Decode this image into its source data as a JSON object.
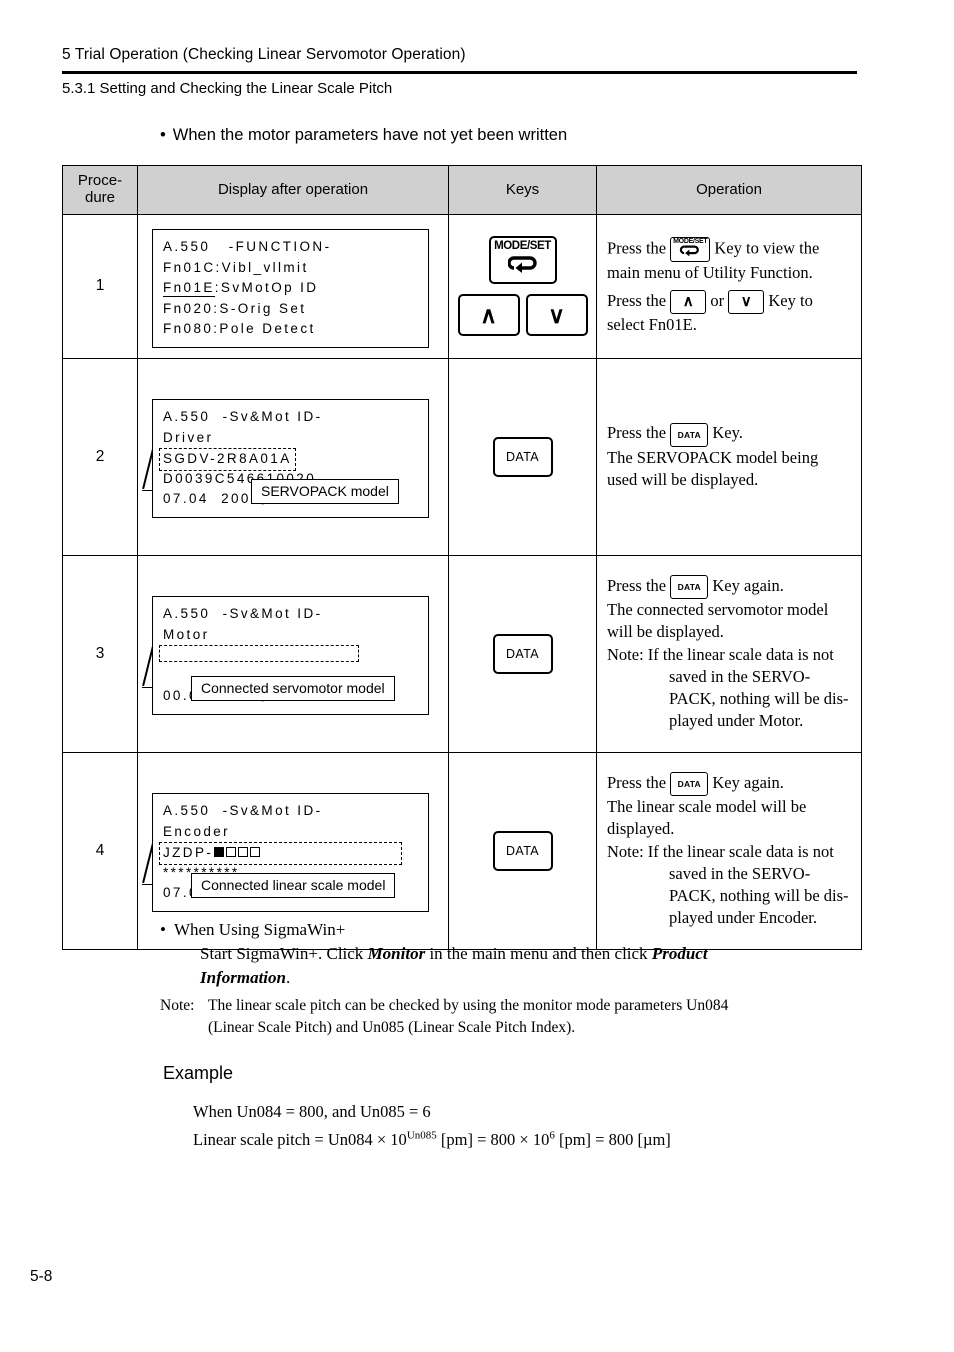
{
  "header": {
    "chapter": "5  Trial Operation (Checking Linear Servomotor Operation)",
    "section": "5.3.1  Setting and Checking the Linear Scale Pitch"
  },
  "intro_bullet": "When the motor parameters have not yet been written",
  "table": {
    "columns": {
      "procedure": "Proce-\ndure",
      "display": "Display after operation",
      "keys": "Keys",
      "operation": "Operation"
    },
    "rows": [
      {
        "number": "1",
        "lcd": {
          "lines": [
            "A.550   -FUNCTION-",
            "Fn01C:Vibl_vllmit",
            "Fn01E:SvMotOp ID",
            "Fn020:S-Orig Set",
            "Fn080:Pole Detect"
          ],
          "selected_prefix": "Fn01E",
          "selected_rest": ":SvMotOp ID"
        },
        "keys": {
          "modeset_label": "MODE/SET",
          "up_label": "∧",
          "down_label": "∨"
        },
        "operation": {
          "l1a": "Press the",
          "l1b": "Key to view the",
          "l2": "main menu of Utility Function.",
          "l3a": "Press the",
          "l3b": "or",
          "l3c": "Key to",
          "l4": "select Fn01E."
        }
      },
      {
        "number": "2",
        "lcd": {
          "line1": "A.550  -Sv&Mot ID-",
          "line2": "Driver",
          "boxed": "SGDV-2R8A01A",
          "line4": "D0039C546610020",
          "line5": "07.04  200V,  400W"
        },
        "callout": "SERVOPACK model",
        "keys": {
          "data_label": "DATA"
        },
        "operation": {
          "l1a": "Press the",
          "l1b": "Key.",
          "l2": "The SERVOPACK model being",
          "l3": "used will be displayed."
        }
      },
      {
        "number": "3",
        "lcd": {
          "line1": "A.550  -Sv&Mot ID-",
          "line2": "Motor",
          "boxed": "",
          "line4": "",
          "line5": "00.00  100V,      W"
        },
        "callout": "Connected servomotor model",
        "keys": {
          "data_label": "DATA"
        },
        "operation": {
          "l1a": "Press the",
          "l1b": "Key again.",
          "l2": "The connected servomotor model",
          "l3": "will be displayed.",
          "l4": "Note: If the linear scale data is not",
          "l5": "saved in the SERVO-",
          "l6": "PACK, nothing will be dis-",
          "l7": "played under Motor."
        }
      },
      {
        "number": "4",
        "lcd": {
          "line1": "A.550  -Sv&Mot ID-",
          "line2": "Encoder",
          "boxed_prefix": "JZDP-",
          "boxed_squares": [
            "filled",
            "hollow",
            "hollow",
            "hollow"
          ],
          "line4": "**********",
          "line5": "07.04  09bit-ABS"
        },
        "callout": "Connected linear scale model",
        "keys": {
          "data_label": "DATA"
        },
        "operation": {
          "l1a": "Press the",
          "l1b": "Key again.",
          "l2": "The linear scale model will be",
          "l3": "displayed.",
          "l4": "Note: If the linear scale data is not",
          "l5": "saved in the SERVO-",
          "l6": "PACK, nothing will be dis-",
          "l7": "played under Encoder."
        }
      }
    ]
  },
  "sigmawin": {
    "bullet": "When Using SigmaWin+",
    "line1_a": "Start SigmaWin+. Click ",
    "line1_bold": "Monitor",
    "line1_b": " in the main menu and then click ",
    "line1_bold2": "Product",
    "line2_bold": "Information",
    "line2_after": "."
  },
  "note": {
    "label": "Note:",
    "line1": "The linear scale pitch can be checked by using the monitor mode parameters Un084",
    "line2": "(Linear Scale Pitch) and Un085 (Linear Scale Pitch Index)."
  },
  "example": {
    "heading": "Example",
    "line1": "When Un084 = 800, and Un085 = 6",
    "line2_a": "Linear scale pitch = Un084 × 10",
    "line2_sup1": "Un085",
    "line2_b": " [pm] = 800 × 10",
    "line2_sup2": "6",
    "line2_c": " [pm] = 800 [µm]"
  },
  "page_number": "5-8"
}
